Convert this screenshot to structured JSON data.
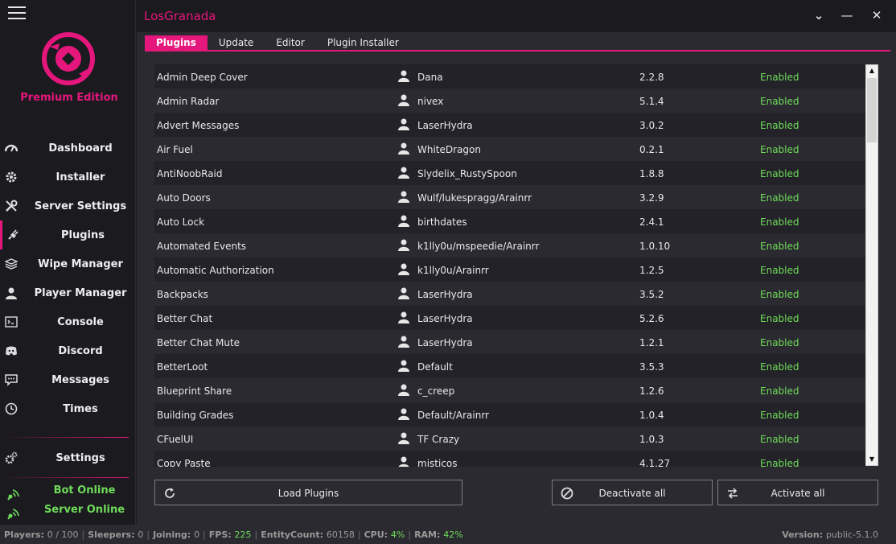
{
  "app": {
    "title": "LosGranada",
    "edition": "Premium Edition"
  },
  "window_controls": {
    "collapse": "⌄",
    "minimize": "—",
    "close": "✕"
  },
  "sidebar": {
    "items": [
      {
        "label": "Dashboard",
        "icon": "speedometer-icon"
      },
      {
        "label": "Installer",
        "icon": "gear-icon"
      },
      {
        "label": "Server Settings",
        "icon": "wrench-icon"
      },
      {
        "label": "Plugins",
        "icon": "plug-icon",
        "active": true
      },
      {
        "label": "Wipe Manager",
        "icon": "layers-icon"
      },
      {
        "label": "Player Manager",
        "icon": "user-icon"
      },
      {
        "label": "Console",
        "icon": "terminal-icon"
      },
      {
        "label": "Discord",
        "icon": "discord-icon"
      },
      {
        "label": "Messages",
        "icon": "chat-icon"
      },
      {
        "label": "Times",
        "icon": "clock-icon"
      }
    ],
    "settings_label": "Settings",
    "status": [
      {
        "label": "Bot Online"
      },
      {
        "label": "Server Online"
      }
    ]
  },
  "tabs": [
    {
      "label": "Plugins",
      "active": true
    },
    {
      "label": "Update"
    },
    {
      "label": "Editor"
    },
    {
      "label": "Plugin Installer"
    }
  ],
  "plugins": [
    {
      "name": "Admin Deep Cover",
      "author": "Dana",
      "version": "2.2.8",
      "status": "Enabled"
    },
    {
      "name": "Admin Radar",
      "author": "nivex",
      "version": "5.1.4",
      "status": "Enabled"
    },
    {
      "name": "Advert Messages",
      "author": "LaserHydra",
      "version": "3.0.2",
      "status": "Enabled"
    },
    {
      "name": "Air Fuel",
      "author": "WhiteDragon",
      "version": "0.2.1",
      "status": "Enabled"
    },
    {
      "name": "AntiNoobRaid",
      "author": "Slydelix_RustySpoon",
      "version": "1.8.8",
      "status": "Enabled"
    },
    {
      "name": "Auto Doors",
      "author": "Wulf/lukespragg/Arainrr",
      "version": "3.2.9",
      "status": "Enabled"
    },
    {
      "name": "Auto Lock",
      "author": "birthdates",
      "version": "2.4.1",
      "status": "Enabled"
    },
    {
      "name": "Automated Events",
      "author": "k1lly0u/mspeedie/Arainrr",
      "version": "1.0.10",
      "status": "Enabled"
    },
    {
      "name": "Automatic Authorization",
      "author": "k1lly0u/Arainrr",
      "version": "1.2.5",
      "status": "Enabled"
    },
    {
      "name": "Backpacks",
      "author": "LaserHydra",
      "version": "3.5.2",
      "status": "Enabled"
    },
    {
      "name": "Better Chat",
      "author": "LaserHydra",
      "version": "5.2.6",
      "status": "Enabled"
    },
    {
      "name": "Better Chat Mute",
      "author": "LaserHydra",
      "version": "1.2.1",
      "status": "Enabled"
    },
    {
      "name": "BetterLoot",
      "author": "Default",
      "version": "3.5.3",
      "status": "Enabled"
    },
    {
      "name": "Blueprint Share",
      "author": "c_creep",
      "version": "1.2.6",
      "status": "Enabled"
    },
    {
      "name": "Building Grades",
      "author": "Default/Arainrr",
      "version": "1.0.4",
      "status": "Enabled"
    },
    {
      "name": "CFuelUI",
      "author": "TF Crazy",
      "version": "1.0.3",
      "status": "Enabled"
    },
    {
      "name": "Copy Paste",
      "author": "misticos",
      "version": "4.1.27",
      "status": "Enabled"
    }
  ],
  "buttons": {
    "load": "Load Plugins",
    "deactivate": "Deactivate all",
    "activate": "Activate all"
  },
  "statusbar": {
    "players_label": "Players:",
    "players_value": "0 / 100",
    "sleepers_label": "Sleepers:",
    "sleepers_value": "0",
    "joining_label": "Joining:",
    "joining_value": "0",
    "fps_label": "FPS:",
    "fps_value": "225",
    "entity_label": "EntityCount:",
    "entity_value": "60158",
    "cpu_label": "CPU:",
    "cpu_value": "4%",
    "ram_label": "RAM:",
    "ram_value": "42%",
    "version_label": "Version:",
    "version_value": "public-5.1.0"
  },
  "colors": {
    "accent": "#e5177c",
    "online": "#6fdc5a",
    "background": "#1b1a1f",
    "panel": "#2b2a30"
  }
}
